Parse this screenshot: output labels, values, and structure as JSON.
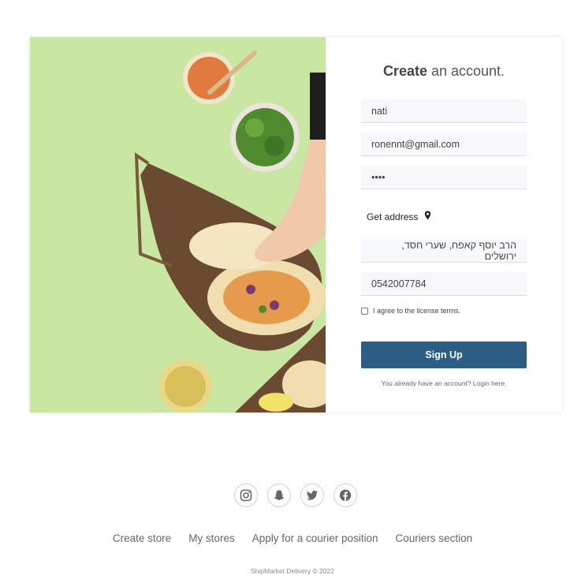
{
  "form": {
    "title_bold": "Create",
    "title_rest": " an account.",
    "name_value": "nati",
    "email_value": "ronennt@gmail.com",
    "password_value": "••••",
    "get_address_label": "Get address",
    "address_value": "הרב יוסף קאפח, שערי חסד, ירושלים",
    "phone_value": "0542007784",
    "terms_label": "I agree to the license terms.",
    "signup_label": "Sign Up",
    "login_text": "You already have an account? Login here."
  },
  "social": [
    "instagram-icon",
    "snapchat-icon",
    "twitter-icon",
    "facebook-icon"
  ],
  "footer": {
    "links": [
      "Create store",
      "My stores",
      "Apply for a courier position",
      "Couriers section"
    ],
    "copyright": "ShipMarket Delivery © 2022"
  },
  "colors": {
    "primary_button": "#2c5d85",
    "photo_background": "#c9e6a2",
    "field_background": "#f7f8fb"
  }
}
